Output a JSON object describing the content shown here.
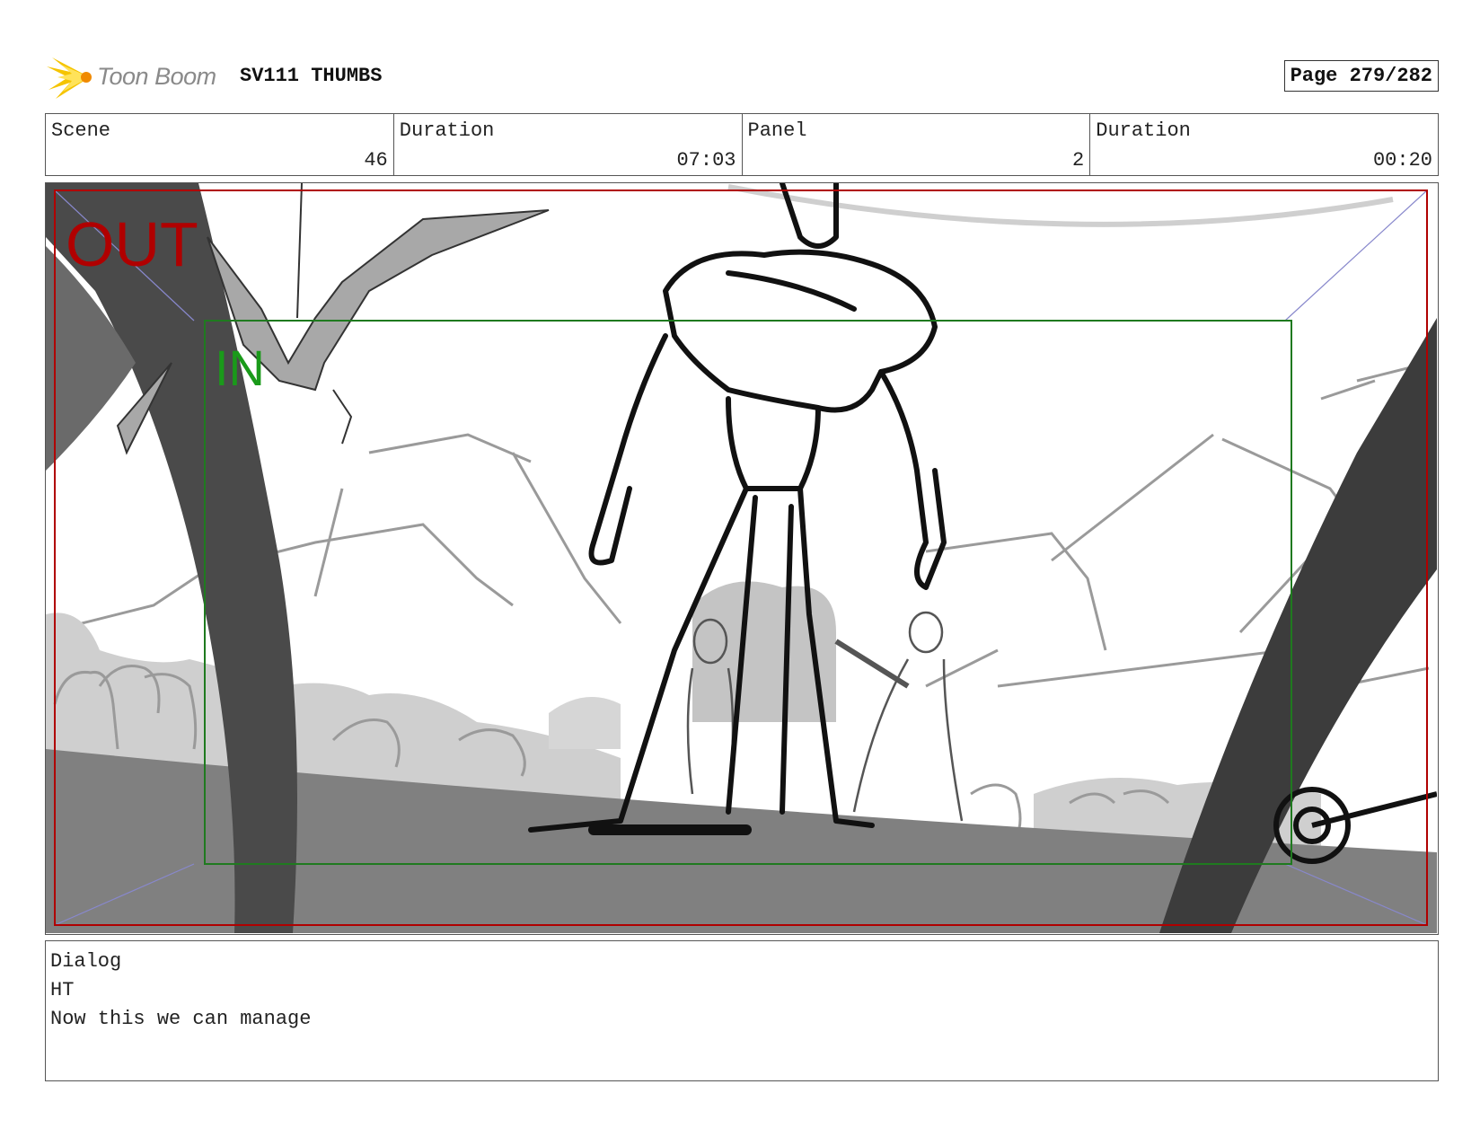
{
  "header": {
    "logo_text": "Toon Boom",
    "title": "SV111 THUMBS",
    "page_label": "Page 279/282"
  },
  "info": {
    "scene": {
      "label": "Scene",
      "value": "46"
    },
    "duration": {
      "label": "Duration",
      "value": "07:03"
    },
    "panel": {
      "label": "Panel",
      "value": "2"
    },
    "panel_duration": {
      "label": "Duration",
      "value": "00:20"
    }
  },
  "frame": {
    "out_label": "OUT",
    "in_label": "IN",
    "out_color": "#b00000",
    "in_color": "#1a9a1a"
  },
  "dialog": {
    "label": "Dialog",
    "speaker": "HT",
    "line": "Now this we can manage"
  },
  "colors": {
    "logo_flame": "#f5c400",
    "border": "#555555"
  }
}
